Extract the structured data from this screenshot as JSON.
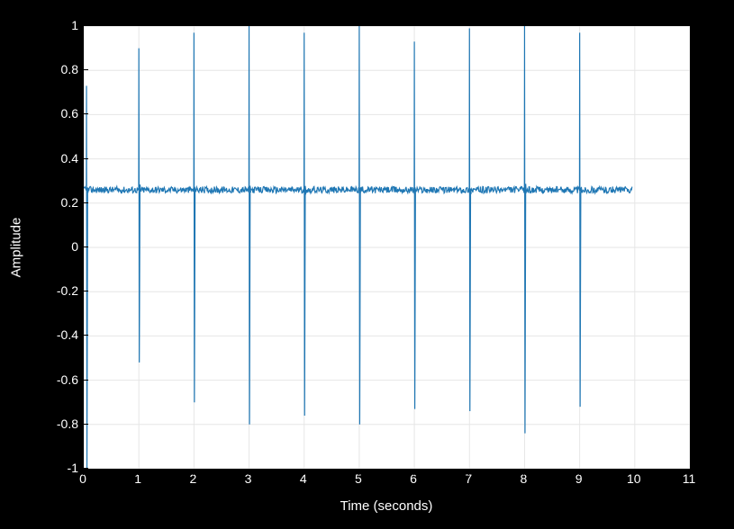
{
  "chart_data": {
    "type": "line",
    "title": "",
    "xlabel": "Time (seconds)",
    "ylabel": "Amplitude",
    "xlim": [
      0,
      11
    ],
    "ylim": [
      -1,
      1
    ],
    "yticks": [
      -1,
      -0.8,
      -0.6,
      -0.4,
      -0.2,
      0,
      0.2,
      0.4,
      0.6,
      0.8,
      1
    ],
    "xticks": [
      0,
      1,
      2,
      3,
      4,
      5,
      6,
      7,
      8,
      9,
      10,
      11
    ],
    "grid": true,
    "legend": false,
    "series_color": "#1f77b4",
    "baseline": 0.26,
    "noise_band": 0.03,
    "spikes": [
      {
        "x": 0.05,
        "pos_peak": 0.73,
        "neg_peak": -1.0
      },
      {
        "x": 1.0,
        "pos_peak": 0.9,
        "neg_peak": -0.52
      },
      {
        "x": 2.0,
        "pos_peak": 0.97,
        "neg_peak": -0.7
      },
      {
        "x": 3.0,
        "pos_peak": 1.0,
        "neg_peak": -0.8
      },
      {
        "x": 4.0,
        "pos_peak": 0.97,
        "neg_peak": -0.76
      },
      {
        "x": 5.0,
        "pos_peak": 1.0,
        "neg_peak": -0.8
      },
      {
        "x": 6.0,
        "pos_peak": 0.93,
        "neg_peak": -0.73
      },
      {
        "x": 7.0,
        "pos_peak": 0.99,
        "neg_peak": -0.74
      },
      {
        "x": 8.0,
        "pos_peak": 1.0,
        "neg_peak": -0.84
      },
      {
        "x": 9.0,
        "pos_peak": 0.97,
        "neg_peak": -0.72
      }
    ],
    "signal_end_x": 9.95
  },
  "axis_text": {
    "ylabel": "Amplitude",
    "xlabel": "Time (seconds)",
    "yticks": [
      "-1",
      "-0.8",
      "-0.6",
      "-0.4",
      "-0.2",
      "0",
      "0.2",
      "0.4",
      "0.6",
      "0.8",
      "1"
    ],
    "xticks": [
      "0",
      "1",
      "2",
      "3",
      "4",
      "5",
      "6",
      "7",
      "8",
      "9",
      "10",
      "11"
    ]
  }
}
